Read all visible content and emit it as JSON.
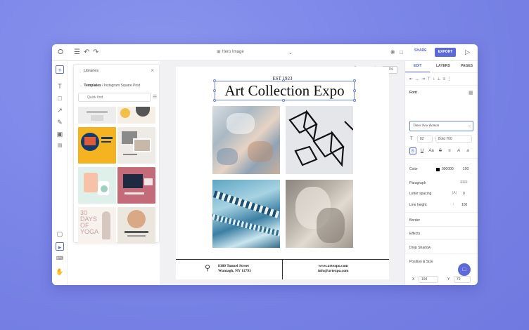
{
  "topbar": {
    "doc_title": "Hero Image",
    "share_label": "SHARE",
    "export_label": "EXPORT"
  },
  "library": {
    "title": "Libraries",
    "breadcrumb_parent": "Templates",
    "breadcrumb_sep": " / ",
    "breadcrumb_current": "Instagram Square Post",
    "search_placeholder": "Quick find",
    "thumb_text_1": "30 DAYS OF YOGA"
  },
  "canvas": {
    "zoom_value": "65%",
    "est": "EST 1923",
    "title": "Art Collection Expo",
    "address_line1": "8380 Tunnel Street",
    "address_line2": "Wantagh, NY 11793",
    "web_line1": "www.artexpo.com",
    "web_line2": "info@artexpo.com"
  },
  "right_panel": {
    "tabs": [
      "EDIT",
      "LAYERS",
      "PAGES"
    ],
    "font_section": "Font",
    "font_family": "Times New Roman",
    "font_size": "82",
    "font_weight": "Bold 700",
    "color_label": "Color",
    "color_hex": "000000",
    "opacity": "100",
    "paragraph_label": "Paragraph",
    "letter_spacing_label": "Letter spacing",
    "letter_spacing_value": "0",
    "line_height_label": "Line height",
    "line_height_value": "100",
    "border_label": "Border",
    "effects_label": "Effects",
    "drop_shadow_label": "Drop Shadow",
    "position_size_label": "Position & Size",
    "x_label": "X",
    "x_value": "194",
    "y_label": "Y",
    "y_value": "79",
    "w_label": "W",
    "w_value": "707",
    "h_label": "H",
    "h_value": "58"
  },
  "colors": {
    "accent": "#5b6ad8",
    "background": "#7b86e8"
  }
}
